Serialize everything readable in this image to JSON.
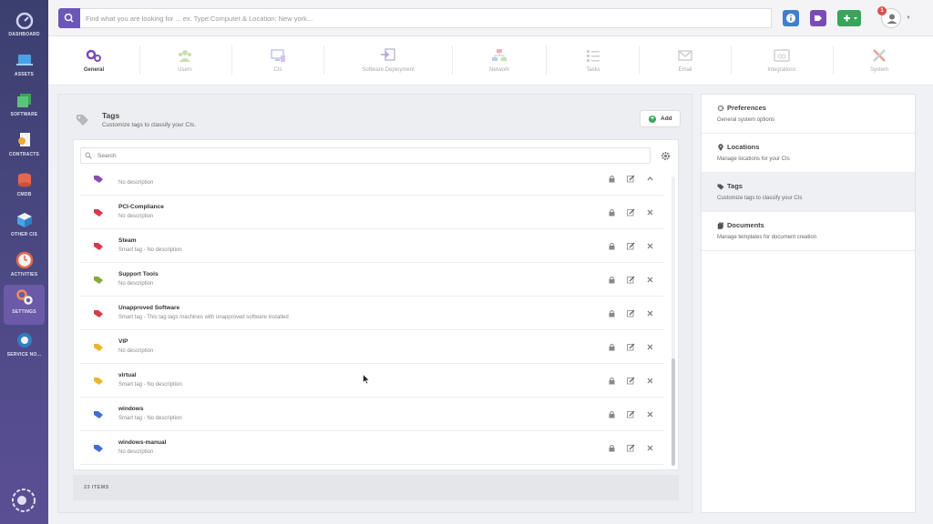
{
  "sidebar": {
    "items": [
      {
        "label": "DASHBOARD",
        "icon": "gauge-icon"
      },
      {
        "label": "ASSETS",
        "icon": "laptop-icon"
      },
      {
        "label": "SOFTWARE",
        "icon": "windows-icon"
      },
      {
        "label": "CONTRACTS",
        "icon": "contract-icon"
      },
      {
        "label": "CMDB",
        "icon": "database-icon"
      },
      {
        "label": "OTHER CIS",
        "icon": "boxes-icon"
      },
      {
        "label": "ACTIVITIES",
        "icon": "clock-icon"
      },
      {
        "label": "SETTINGS",
        "icon": "gears-icon"
      },
      {
        "label": "SERVICE NO...",
        "icon": "service-icon"
      }
    ]
  },
  "search": {
    "placeholder": "Find what you are looking for ... ex. Type:Computer & Location: New york..."
  },
  "topbar": {
    "notifications": "1"
  },
  "tabs": [
    {
      "label": "General"
    },
    {
      "label": "Users"
    },
    {
      "label": "CIs"
    },
    {
      "label": "Software Deployment"
    },
    {
      "label": "Network"
    },
    {
      "label": "Tasks"
    },
    {
      "label": "Email"
    },
    {
      "label": "Integrations"
    },
    {
      "label": "System"
    }
  ],
  "main": {
    "title": "Tags",
    "subtitle": "Customize tags to classify your CIs.",
    "add_label": "Add",
    "search_placeholder": "Search",
    "footer": "23 ITEMS",
    "rows": [
      {
        "name": "",
        "desc": "No description",
        "color": "#8a4bb5"
      },
      {
        "name": "PCI-Compliance",
        "desc": "No description",
        "color": "#d9394e"
      },
      {
        "name": "Steam",
        "desc": "Smart tag - No description",
        "color": "#d9394e"
      },
      {
        "name": "Support Tools",
        "desc": "No description",
        "color": "#8aa83a"
      },
      {
        "name": "Unapproved Software",
        "desc": "Smart tag - This tag tags machines with unapproved software installed",
        "color": "#d9394e"
      },
      {
        "name": "VIP",
        "desc": "No description",
        "color": "#f0b428"
      },
      {
        "name": "virtual",
        "desc": "Smart tag - No description",
        "color": "#f0b428"
      },
      {
        "name": "windows",
        "desc": "Smart tag - No description",
        "color": "#3f6fd0"
      },
      {
        "name": "windows-manual",
        "desc": "No description",
        "color": "#3f6fd0"
      }
    ]
  },
  "right_menu": [
    {
      "title": "Preferences",
      "desc": "General system options",
      "icon": "gear-icon"
    },
    {
      "title": "Locations",
      "desc": "Manage locations for your CIs",
      "icon": "map-pin-icon"
    },
    {
      "title": "Tags",
      "desc": "Customize tags to classify your CIs",
      "icon": "tags-icon"
    },
    {
      "title": "Documents",
      "desc": "Manage templates for document creation",
      "icon": "documents-icon"
    }
  ],
  "colors": {
    "accent": "#6b57b5",
    "sidebar": "#4e4a86",
    "green": "#3aa55a",
    "blue": "#3f7fd0"
  }
}
